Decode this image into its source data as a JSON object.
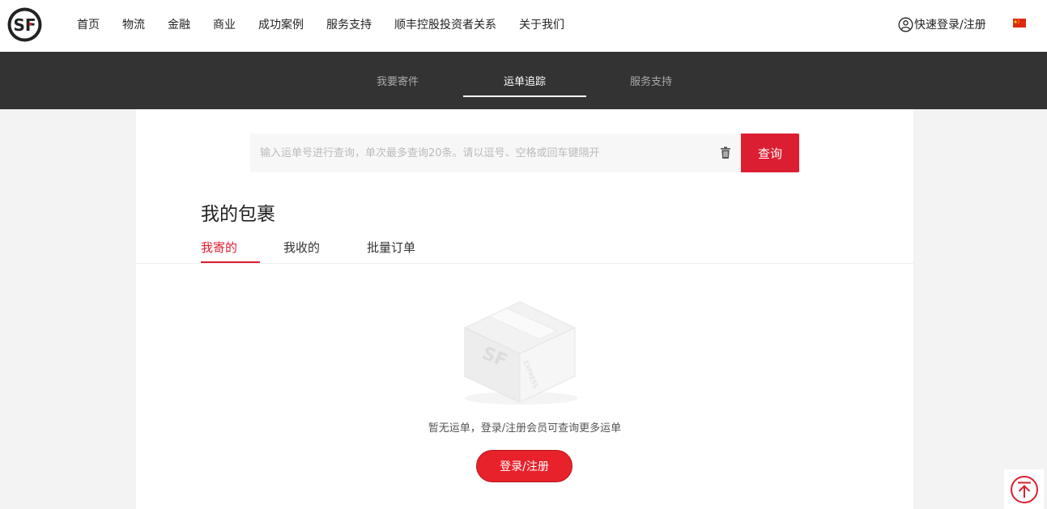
{
  "header": {
    "nav": [
      "首页",
      "物流",
      "金融",
      "商业",
      "成功案例",
      "服务支持",
      "顺丰控股投资者关系",
      "关于我们"
    ],
    "login_label": "快速登录/注册"
  },
  "subnav": {
    "items": [
      {
        "label": "我要寄件",
        "active": false
      },
      {
        "label": "运单追踪",
        "active": true
      },
      {
        "label": "服务支持",
        "active": false
      }
    ]
  },
  "search": {
    "placeholder": "输入运单号进行查询，单次最多查询20条。请以逗号、空格或回车键隔开",
    "value": "",
    "button_label": "查询"
  },
  "parcels": {
    "title": "我的包裹",
    "tabs": [
      "我寄的",
      "我收的",
      "批量订单"
    ],
    "active_tab": "我寄的",
    "empty_text": "暂无运单，登录/注册会员可查询更多运单",
    "login_button": "登录/注册"
  },
  "colors": {
    "brand_red": "#dc1e32",
    "subnav_bg": "#333333"
  }
}
